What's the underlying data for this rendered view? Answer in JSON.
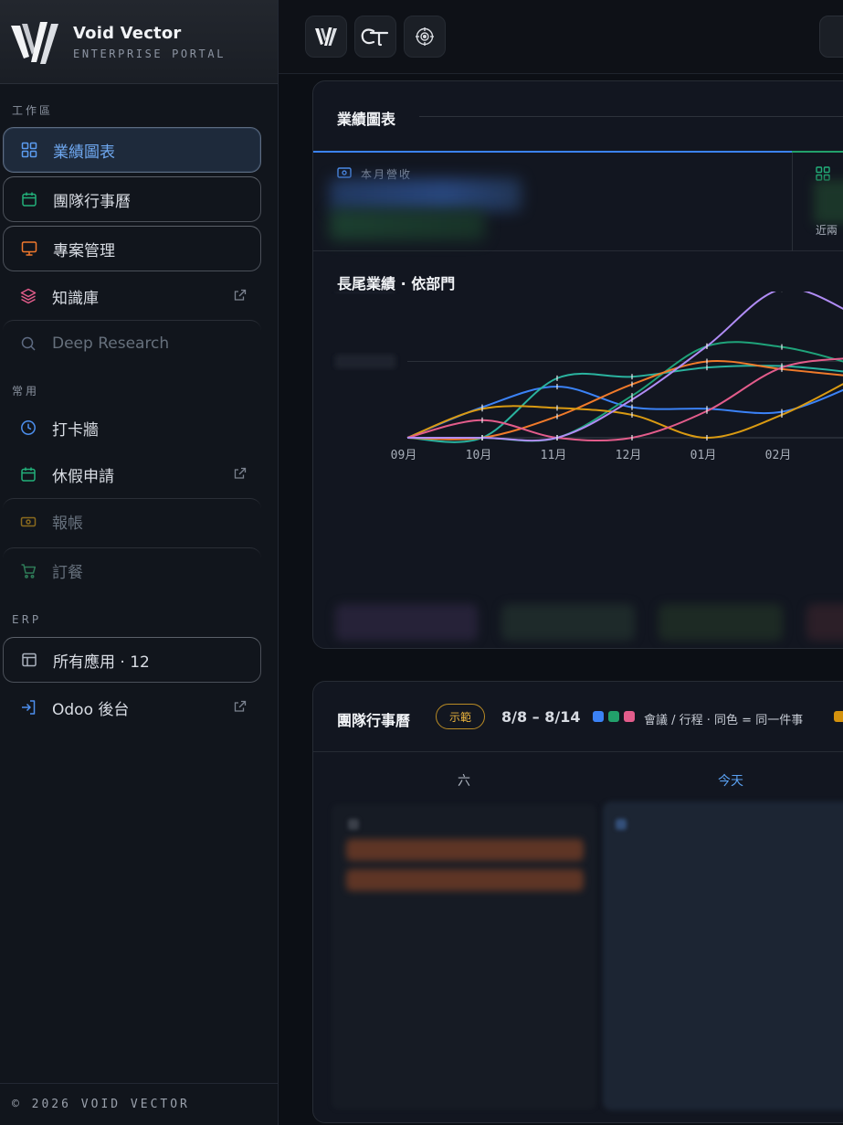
{
  "brand": {
    "title": "Void Vector",
    "subtitle": "ENTERPRISE PORTAL"
  },
  "sidebar": {
    "sections": [
      {
        "label": "工作區"
      },
      {
        "label": "常用"
      },
      {
        "label": "ERP"
      }
    ],
    "workspace": [
      {
        "label": "業績圖表",
        "icon": "grid-icon",
        "state": "active"
      },
      {
        "label": "團隊行事曆",
        "icon": "calendar-icon"
      },
      {
        "label": "專案管理",
        "icon": "monitor-icon"
      },
      {
        "label": "知識庫",
        "icon": "layers-icon",
        "external": true
      },
      {
        "label": "Deep Research",
        "icon": "search-icon",
        "state": "dim"
      }
    ],
    "common": [
      {
        "label": "打卡牆",
        "icon": "clock-icon"
      },
      {
        "label": "休假申請",
        "icon": "calendar-icon",
        "external": true
      },
      {
        "label": "報帳",
        "icon": "cash-icon",
        "state": "dim"
      },
      {
        "label": "訂餐",
        "icon": "cart-icon",
        "state": "dim"
      }
    ],
    "erp": [
      {
        "label": "所有應用 · 12",
        "icon": "window-icon"
      },
      {
        "label": "Odoo 後台",
        "icon": "login-icon",
        "external": true
      }
    ],
    "footer": "© 2026 VOID VECTOR"
  },
  "topbar": {
    "buttons": [
      "void-vector-logo-icon",
      "ct-logo-icon",
      "target-icon"
    ]
  },
  "performance": {
    "title": "業績圖表",
    "kpi_revenue_label": "本月營收",
    "kpi2_label": "近兩"
  },
  "chart_data": {
    "type": "line",
    "title": "長尾業績 · 依部門",
    "categories": [
      "09月",
      "10月",
      "11月",
      "12月",
      "01月",
      "02月"
    ],
    "ylim": [
      0,
      3
    ],
    "grid": true,
    "series": [
      {
        "color": "#3b82f6",
        "values": [
          0,
          0.4,
          0.67,
          0.4,
          0.38,
          0.34,
          0.7
        ]
      },
      {
        "color": "#1fa37a",
        "values": [
          0,
          0,
          0,
          0.55,
          1.2,
          1.19,
          0.95
        ]
      },
      {
        "color": "#2ab39f",
        "values": [
          0,
          0,
          0.78,
          0.8,
          0.92,
          0.94,
          0.85
        ]
      },
      {
        "color": "#f07a2a",
        "values": [
          0,
          0,
          0.28,
          0.7,
          1.0,
          0.9,
          0.8
        ]
      },
      {
        "color": "#d99a12",
        "values": [
          0,
          0.38,
          0.39,
          0.3,
          0,
          0.3,
          0.8
        ]
      },
      {
        "color": "#e35c8b",
        "values": [
          0,
          0.23,
          0,
          0,
          0.35,
          0.92,
          1.05
        ]
      },
      {
        "color": "#b08cf5",
        "values": [
          0,
          0,
          0,
          0.5,
          1.2,
          1.95,
          1.6
        ]
      }
    ]
  },
  "calendar": {
    "title": "團隊行事曆",
    "badge": "示範",
    "range": "8/8 – 8/14",
    "legend": "會議 / 行程 · 同色 = 同一件事",
    "days": [
      {
        "label": "六"
      },
      {
        "label": "今天",
        "today": true
      }
    ],
    "colors": {
      "blue": "#3b82f6",
      "green": "#22a06b",
      "pink": "#e35c8b",
      "orange": "#d4920d",
      "today": "#5aa0f0"
    }
  }
}
